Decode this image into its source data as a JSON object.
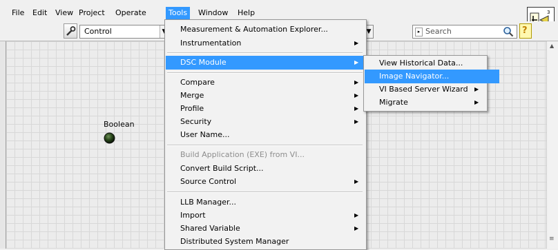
{
  "menubar": {
    "items": [
      "File",
      "Edit",
      "View",
      "Project",
      "Operate",
      "Tools",
      "Window",
      "Help"
    ]
  },
  "toolbar": {
    "palette_combo": "Control",
    "search_placeholder": "Search"
  },
  "canvas": {
    "boolean_label": "Boolean"
  },
  "tools_menu": {
    "items": [
      {
        "label": "Measurement & Automation Explorer..."
      },
      {
        "label": "Instrumentation",
        "submenu": true
      },
      {
        "label": "DSC Module",
        "submenu": true,
        "highlighted": true
      },
      {
        "label": "Compare",
        "submenu": true
      },
      {
        "label": "Merge",
        "submenu": true
      },
      {
        "label": "Profile",
        "submenu": true
      },
      {
        "label": "Security",
        "submenu": true
      },
      {
        "label": "User Name..."
      },
      {
        "label": "Build Application (EXE) from VI...",
        "disabled": true
      },
      {
        "label": "Convert Build Script..."
      },
      {
        "label": "Source Control",
        "submenu": true
      },
      {
        "label": "LLB Manager..."
      },
      {
        "label": "Import",
        "submenu": true
      },
      {
        "label": "Shared Variable",
        "submenu": true
      },
      {
        "label": "Distributed System Manager"
      }
    ]
  },
  "dsc_submenu": {
    "items": [
      {
        "label": "View Historical Data..."
      },
      {
        "label": "Image Navigator...",
        "highlighted": true
      },
      {
        "label": "VI Based Server Wizard",
        "submenu": true
      },
      {
        "label": "Migrate",
        "submenu": true
      }
    ]
  },
  "colors": {
    "highlight": "#3399ff",
    "led_off": "#1d3a12"
  }
}
